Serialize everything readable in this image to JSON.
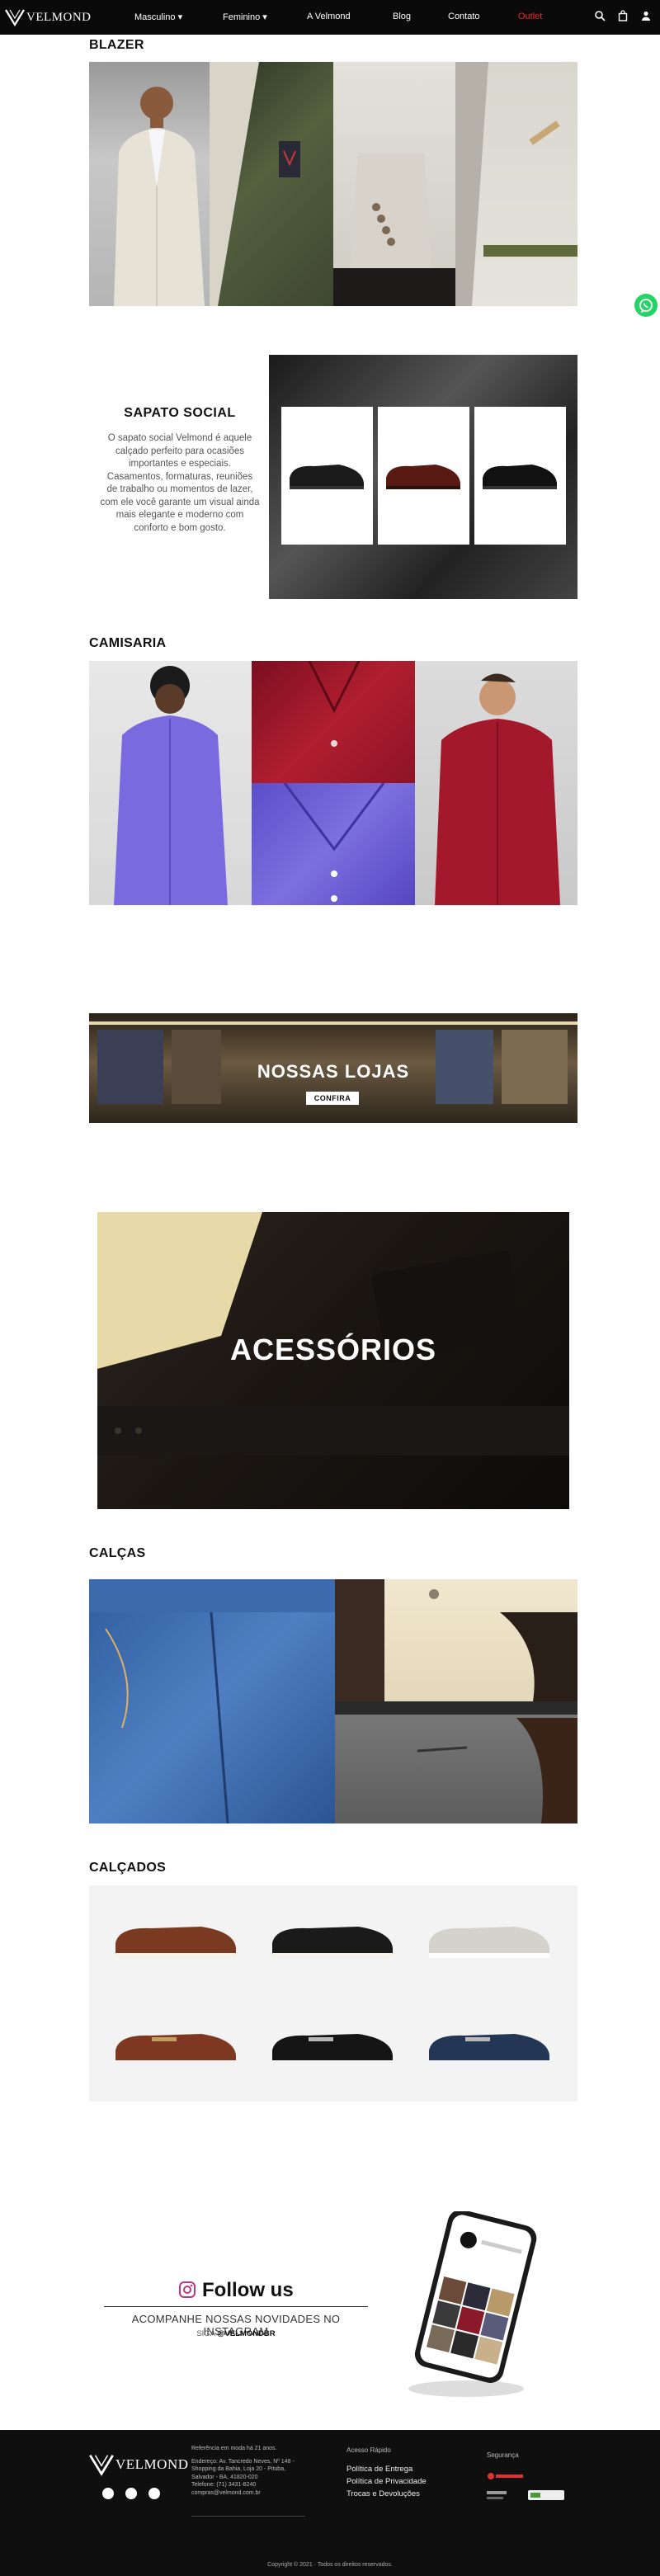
{
  "nav": {
    "brand": "VELMOND",
    "items": [
      "Masculino ▾",
      "Feminino ▾",
      "A Velmond",
      "Blog",
      "Contato",
      "Outlet"
    ],
    "icons": [
      "search-icon",
      "bag-icon",
      "user-icon"
    ]
  },
  "blazer": {
    "title": "BLAZER"
  },
  "sapato": {
    "title": "SAPATO SOCIAL",
    "lines": [
      "O sapato social Velmond é aquele",
      "calçado perfeito para ocasiões",
      "importantes e especiais.",
      "Casamentos, formaturas, reuniões",
      "de trabalho ou momentos de lazer,",
      "com ele você garante um visual ainda",
      "mais elegante e moderno com",
      "conforto e bom gosto."
    ]
  },
  "camisaria": {
    "title": "CAMISARIA"
  },
  "lojas": {
    "title": "NOSSAS LOJAS",
    "button": "CONFIRA"
  },
  "acessorios": {
    "title": "ACESSÓRIOS"
  },
  "calcas": {
    "title": "CALÇAS"
  },
  "calcados": {
    "title": "CALÇADOS"
  },
  "instagram": {
    "follow": "Follow us",
    "subtitle": "ACOMPANHE NOSSAS NOVIDADES NO INSTAGRAM",
    "siga": "SIGA",
    "handle": "@VELMONDBR"
  },
  "footer": {
    "brand": "VELMOND",
    "info": [
      "Referência em moda há 21 anos.",
      "",
      "Endereço: Av. Tancredo Neves, Nº 148 -",
      "Shopping da Bahia, Loja 20 - Pituba,",
      "Salvador - BA, 41820-020",
      "Telefone: (71) 3431-8240",
      "compras@velmond.com.br"
    ],
    "acesso_title": "Acesso Rápido",
    "links": [
      "Política de Entrega",
      "Política de Privacidade",
      "Trocas e Devoluções"
    ],
    "seguranca_title": "Segurança",
    "copyright": "Copyright © 2021 · Todos os direitos reservados."
  }
}
